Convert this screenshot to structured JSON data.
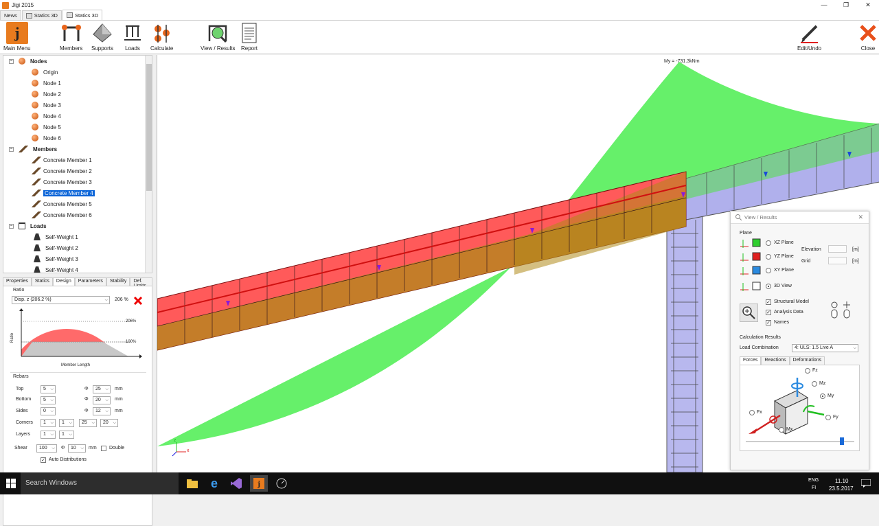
{
  "window": {
    "title": "Jigi 2015",
    "controls": [
      "—",
      "❐",
      "✕"
    ]
  },
  "tabs": [
    {
      "label": "News"
    },
    {
      "label": "Statics 3D"
    },
    {
      "label": "Statics 3D"
    }
  ],
  "ribbon": {
    "main_menu": "Main Menu",
    "members": "Members",
    "supports": "Supports",
    "loads": "Loads",
    "calculate": "Calculate",
    "view_results": "View / Results",
    "report": "Report",
    "edit_undo": "Edit/Undo",
    "close": "Close"
  },
  "tree": {
    "nodes_label": "Nodes",
    "nodes": [
      "Origin",
      "Node 1",
      "Node 2",
      "Node 3",
      "Node 4",
      "Node 5",
      "Node 6"
    ],
    "members_label": "Members",
    "members": [
      "Concrete Member 1",
      "Concrete Member 2",
      "Concrete Member 3",
      "Concrete Member 4",
      "Concrete Member 5",
      "Concrete Member 6"
    ],
    "selected_member": "Concrete Member 4",
    "loads_label": "Loads",
    "loads": [
      "Self-Weight 1",
      "Self-Weight 2",
      "Self-Weight 3",
      "Self-Weight 4"
    ]
  },
  "panel_tabs": [
    "Properties",
    "Statics",
    "Design",
    "Parameters",
    "Stability",
    "Def. Limits"
  ],
  "design": {
    "ratio_title": "Ratio",
    "ratio_select": "Disp. z (206.2 %)",
    "ratio_value": "206 %",
    "chart_top": "206%",
    "chart_mid": "100%",
    "y_axis": "Ratio",
    "x_axis": "Member Length",
    "rebars_title": "Rebars",
    "phi": "Φ",
    "mm": "mm",
    "top_label": "Top",
    "top_count": "5",
    "top_dia": "25",
    "bottom_label": "Bottom",
    "bottom_count": "5",
    "bottom_dia": "20",
    "sides_label": "Sides",
    "sides_count": "0",
    "sides_dia": "12",
    "corners_label": "Corners",
    "corners_a": "1",
    "corners_b": "1",
    "corners_c": "25",
    "corners_d": "20",
    "layers_label": "Layers",
    "layers_a": "1",
    "layers_b": "1",
    "shear_label": "Shear",
    "shear_spacing": "100",
    "shear_dia": "10",
    "double_label": "Double",
    "auto_dist_label": "Auto Distributions"
  },
  "viewport": {
    "moment_label": "My = -731.3kNm",
    "axis_x": "x",
    "axis_z": "z"
  },
  "view_results": {
    "title": "View / Results",
    "plane_label": "Plane",
    "xz": "XZ Plane",
    "yz": "YZ Plane",
    "xy": "XY Plane",
    "view3d": "3D View",
    "elevation": "Elevation",
    "grid": "Grid",
    "unit": "[m]",
    "structural_model": "Structural Model",
    "analysis_data": "Analysis Data",
    "names": "Names",
    "calc_results": "Calculation Results",
    "load_comb_label": "Load Combination",
    "load_comb_value": "4: ULS: 1.5 Live A",
    "result_tabs": [
      "Forces",
      "Reactions",
      "Deformations"
    ],
    "forces": {
      "fz": "Fz",
      "mz": "Mz",
      "my": "My",
      "fy": "Fy",
      "fx": "Fx",
      "mx": "Mx"
    }
  },
  "taskbar": {
    "search_placeholder": "Search Windows",
    "lang_top": "ENG",
    "lang_bottom": "FI",
    "time": "11.10",
    "date": "23.5.2017"
  },
  "colors": {
    "moment_diagram": "#66f06a",
    "selected_member": "#ff3c3c",
    "member": "#a8a8e6",
    "accent": "#0a64d8"
  }
}
